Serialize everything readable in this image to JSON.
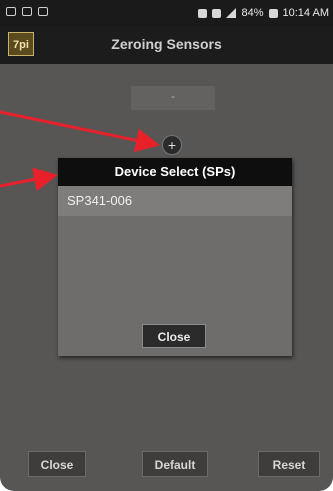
{
  "status_bar": {
    "battery": "84%",
    "time": "10:14 AM"
  },
  "app_bar": {
    "logo": "7pi",
    "title": "Zeroing Sensors"
  },
  "sensor_field": {
    "value": "-"
  },
  "add_button": {
    "label": "+"
  },
  "dialog": {
    "title": "Device Select (SPs)",
    "items": [
      "SP341-006"
    ],
    "close_label": "Close"
  },
  "footer": {
    "close_label": "Close",
    "default_label": "Default",
    "reset_label": "Reset"
  },
  "colors": {
    "annotation_arrow": "#e8202a",
    "dialog_header": "#0e0e0e",
    "screen_background": "#585654"
  }
}
